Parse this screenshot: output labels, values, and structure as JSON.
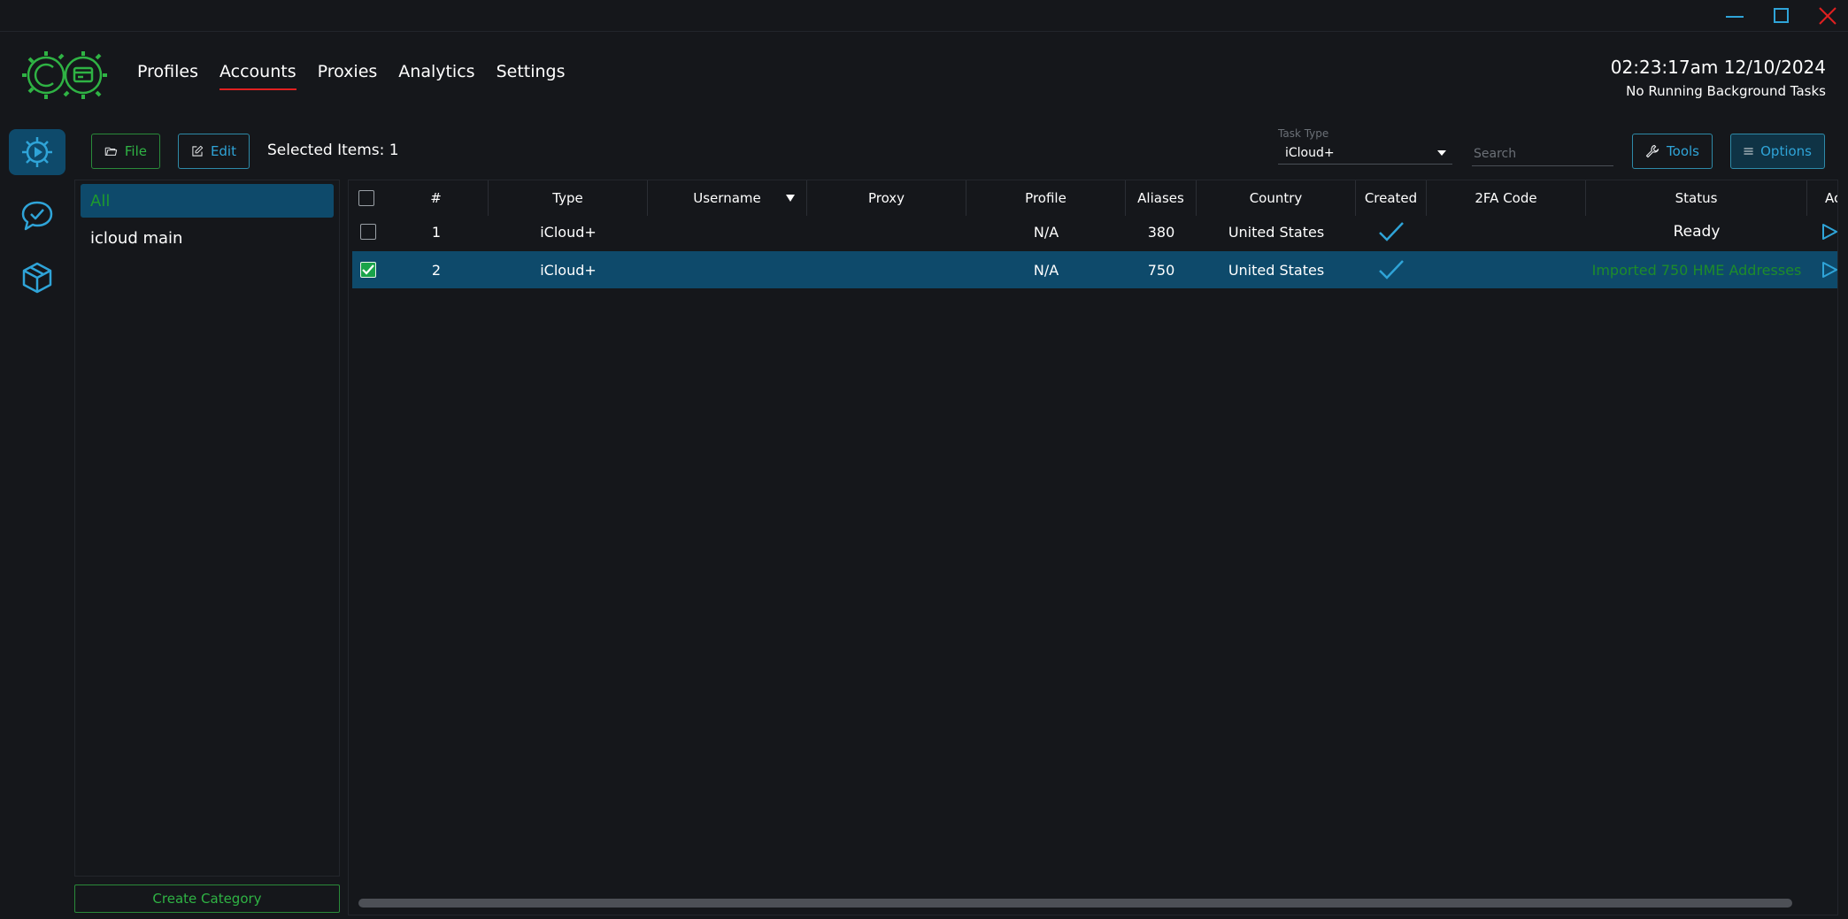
{
  "window": {
    "controls": [
      "minimize",
      "maximize",
      "close"
    ]
  },
  "nav": {
    "items": [
      "Profiles",
      "Accounts",
      "Proxies",
      "Analytics",
      "Settings"
    ],
    "active": "Accounts"
  },
  "clock": {
    "time": "02:23:17am 12/10/2024",
    "tasks": "No Running Background Tasks"
  },
  "sidebar": {
    "icons": [
      "gear-play-icon",
      "chat-check-icon",
      "box-icon"
    ]
  },
  "toolbar": {
    "file_label": "File",
    "edit_label": "Edit",
    "selected_text": "Selected Items: 1",
    "task_type_label": "Task Type",
    "task_type_value": "iCloud+",
    "search_placeholder": "Search",
    "tools_label": "Tools",
    "options_label": "Options"
  },
  "categories": {
    "items": [
      "All",
      "icloud main"
    ],
    "create_label": "Create Category"
  },
  "table": {
    "headers": [
      "#",
      "Type",
      "Username",
      "Proxy",
      "Profile",
      "Aliases",
      "Country",
      "Created",
      "2FA Code",
      "Status",
      "Action"
    ],
    "rows": [
      {
        "num": "1",
        "type": "iCloud+",
        "username": "",
        "proxy": "",
        "profile": "N/A",
        "aliases": "380",
        "country": "United States",
        "created": true,
        "twofa": "",
        "status": "Ready",
        "checked": false
      },
      {
        "num": "2",
        "type": "iCloud+",
        "username": "",
        "proxy": "",
        "profile": "N/A",
        "aliases": "750",
        "country": "United States",
        "created": true,
        "twofa": "",
        "status": "Imported 750 HME Addresses",
        "checked": true
      }
    ]
  },
  "colors": {
    "accent_blue": "#2fa4d8",
    "accent_green": "#2fb344",
    "selected_row": "#0e4a6b",
    "active_tab_underline": "#e02020"
  }
}
